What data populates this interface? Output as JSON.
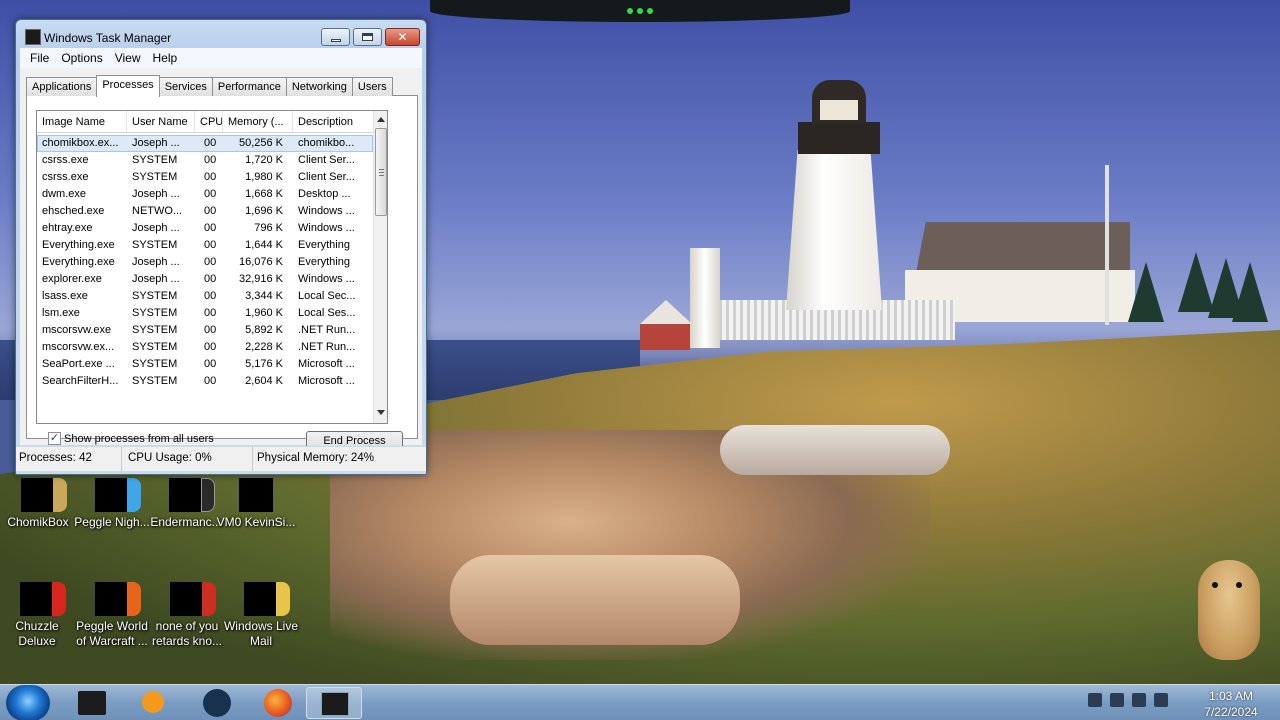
{
  "window": {
    "title": "Windows Task Manager",
    "close_glyph": "✕",
    "menu": [
      "File",
      "Options",
      "View",
      "Help"
    ],
    "tabs": [
      "Applications",
      "Processes",
      "Services",
      "Performance",
      "Networking",
      "Users"
    ],
    "active_tab": "Processes",
    "columns": [
      "Image Name",
      "User Name",
      "CPU",
      "Memory (...",
      "Description"
    ],
    "rows": [
      [
        "chomikbox.ex...",
        "Joseph ...",
        "00",
        "50,256 K",
        "chomikbo..."
      ],
      [
        "csrss.exe",
        "SYSTEM",
        "00",
        "1,720 K",
        "Client Ser..."
      ],
      [
        "csrss.exe",
        "SYSTEM",
        "00",
        "1,980 K",
        "Client Ser..."
      ],
      [
        "dwm.exe",
        "Joseph ...",
        "00",
        "1,668 K",
        "Desktop ..."
      ],
      [
        "ehsched.exe",
        "NETWO...",
        "00",
        "1,696 K",
        "Windows ..."
      ],
      [
        "ehtray.exe",
        "Joseph ...",
        "00",
        "796 K",
        "Windows ..."
      ],
      [
        "Everything.exe",
        "SYSTEM",
        "00",
        "1,644 K",
        "Everything"
      ],
      [
        "Everything.exe",
        "Joseph ...",
        "00",
        "16,076 K",
        "Everything"
      ],
      [
        "explorer.exe",
        "Joseph ...",
        "00",
        "32,916 K",
        "Windows ..."
      ],
      [
        "lsass.exe",
        "SYSTEM",
        "00",
        "3,344 K",
        "Local Sec..."
      ],
      [
        "lsm.exe",
        "SYSTEM",
        "00",
        "1,960 K",
        "Local Ses..."
      ],
      [
        "mscorsvw.exe",
        "SYSTEM",
        "00",
        "5,892 K",
        ".NET Run..."
      ],
      [
        "mscorsvw.ex...",
        "SYSTEM",
        "00",
        "2,228 K",
        ".NET Run..."
      ],
      [
        "SeaPort.exe ...",
        "SYSTEM",
        "00",
        "5,176 K",
        "Microsoft ..."
      ],
      [
        "SearchFilterH...",
        "SYSTEM",
        "00",
        "2,604 K",
        "Microsoft ..."
      ]
    ],
    "selected_row": 0,
    "show_all_label": "Show processes from all users",
    "show_all_checked": true,
    "check_glyph": "✓",
    "end_process_label": "End Process",
    "status": {
      "processes": "Processes: 42",
      "cpu": "CPU Usage: 0%",
      "memory": "Physical Memory: 24%"
    }
  },
  "desktop_icons": [
    {
      "label": "ChomikBox",
      "icon": "chomikbox-icon"
    },
    {
      "label": "Peggle Nigh...",
      "icon": "peggle-nights-icon"
    },
    {
      "label": "Endermanc...",
      "icon": "endermanch-icon"
    },
    {
      "label": "VM0 KevinSi...",
      "icon": "vm-shortcut-icon"
    },
    {
      "label": "Chuzzle Deluxe",
      "icon": "chuzzle-icon"
    },
    {
      "label": "Peggle World of Warcraft ...",
      "icon": "peggle-wow-icon"
    },
    {
      "label": "none of you retards kno...",
      "icon": "custom-shortcut-icon"
    },
    {
      "label": "Windows Live Mail",
      "icon": "windows-live-mail-icon"
    }
  ],
  "taskbar": {
    "pinned": [
      "explorer-icon",
      "media-player-icon",
      "globe-icon",
      "firefox-icon",
      "task-manager-icon"
    ],
    "clock_time": "1:03 AM",
    "clock_date": "7/22/2024"
  }
}
